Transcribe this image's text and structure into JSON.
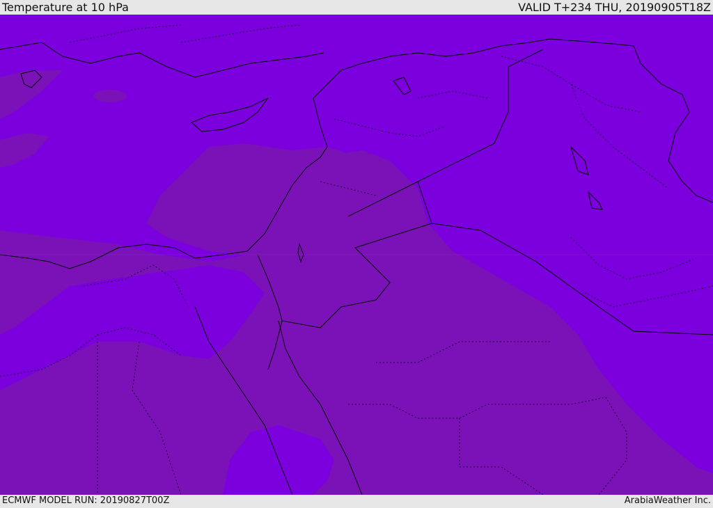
{
  "header": {
    "title": "Temperature at 10 hPa",
    "valid": "VALID T+234 THU, 20190905T18Z"
  },
  "footer": {
    "model_run": "ECMWF MODEL RUN: 20190827T00Z",
    "brand": "ArabiaWeather Inc."
  },
  "colors": {
    "background_field": "#7b00dd",
    "warm_band": "#7a12b8",
    "coastline": "#000000",
    "border_dotted": "#1a0033"
  }
}
